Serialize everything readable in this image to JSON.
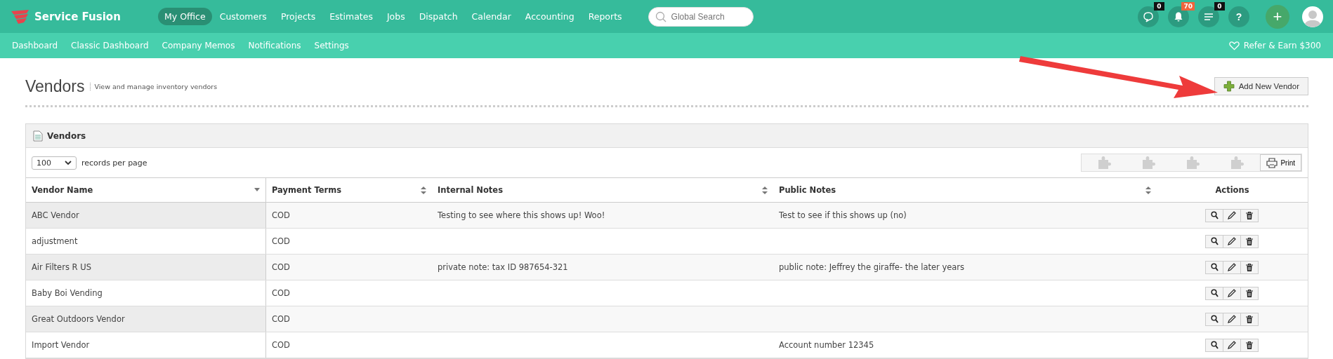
{
  "brand": {
    "name": "Service Fusion"
  },
  "main_nav": [
    {
      "label": "My Office",
      "selected": true
    },
    {
      "label": "Customers",
      "selected": false
    },
    {
      "label": "Projects",
      "selected": false
    },
    {
      "label": "Estimates",
      "selected": false
    },
    {
      "label": "Jobs",
      "selected": false
    },
    {
      "label": "Dispatch",
      "selected": false
    },
    {
      "label": "Calendar",
      "selected": false
    },
    {
      "label": "Accounting",
      "selected": false
    },
    {
      "label": "Reports",
      "selected": false
    }
  ],
  "search": {
    "placeholder": "Global Search"
  },
  "header_icons": [
    {
      "kind": "chat",
      "badge": "0",
      "color": "#111111"
    },
    {
      "kind": "bell",
      "badge": "70",
      "color": "#f0643c"
    },
    {
      "kind": "list",
      "badge": "0",
      "color": "#111111"
    },
    {
      "kind": "help",
      "glyph": "?"
    }
  ],
  "add_button": {
    "glyph": "+"
  },
  "sub_nav": [
    {
      "label": "Dashboard"
    },
    {
      "label": "Classic Dashboard"
    },
    {
      "label": "Company Memos"
    },
    {
      "label": "Notifications"
    },
    {
      "label": "Settings"
    }
  ],
  "refer": {
    "label": "Refer & Earn $300"
  },
  "page": {
    "title": "Vendors",
    "subtitle": "View and manage inventory vendors",
    "action": "Add New Vendor"
  },
  "panel": {
    "title": "Vendors",
    "page_size": "100",
    "page_size_label": "records per page",
    "print": "Print"
  },
  "table": {
    "columns": [
      {
        "label": "Vendor Name",
        "sorted": true
      },
      {
        "label": "Payment Terms",
        "sorted": false
      },
      {
        "label": "Internal Notes",
        "sorted": false
      },
      {
        "label": "Public Notes",
        "sorted": false
      },
      {
        "label": "Actions"
      }
    ],
    "rows": [
      {
        "name": "ABC Vendor",
        "terms": "COD",
        "internal": "Testing to see where this shows up! Woo!",
        "public": "Test to see if this shows up (no)"
      },
      {
        "name": "adjustment",
        "terms": "COD"
      },
      {
        "name": "Air Filters R US",
        "terms": "COD",
        "internal": "private note: tax ID 987654-321",
        "public": "public note: Jeffrey the giraffe- the later years"
      },
      {
        "name": "Baby Boi Vending",
        "terms": "COD"
      },
      {
        "name": "Great Outdoors Vendor",
        "terms": "COD"
      },
      {
        "name": "Import Vendor",
        "terms": "COD",
        "public": "Account number 12345"
      }
    ]
  }
}
